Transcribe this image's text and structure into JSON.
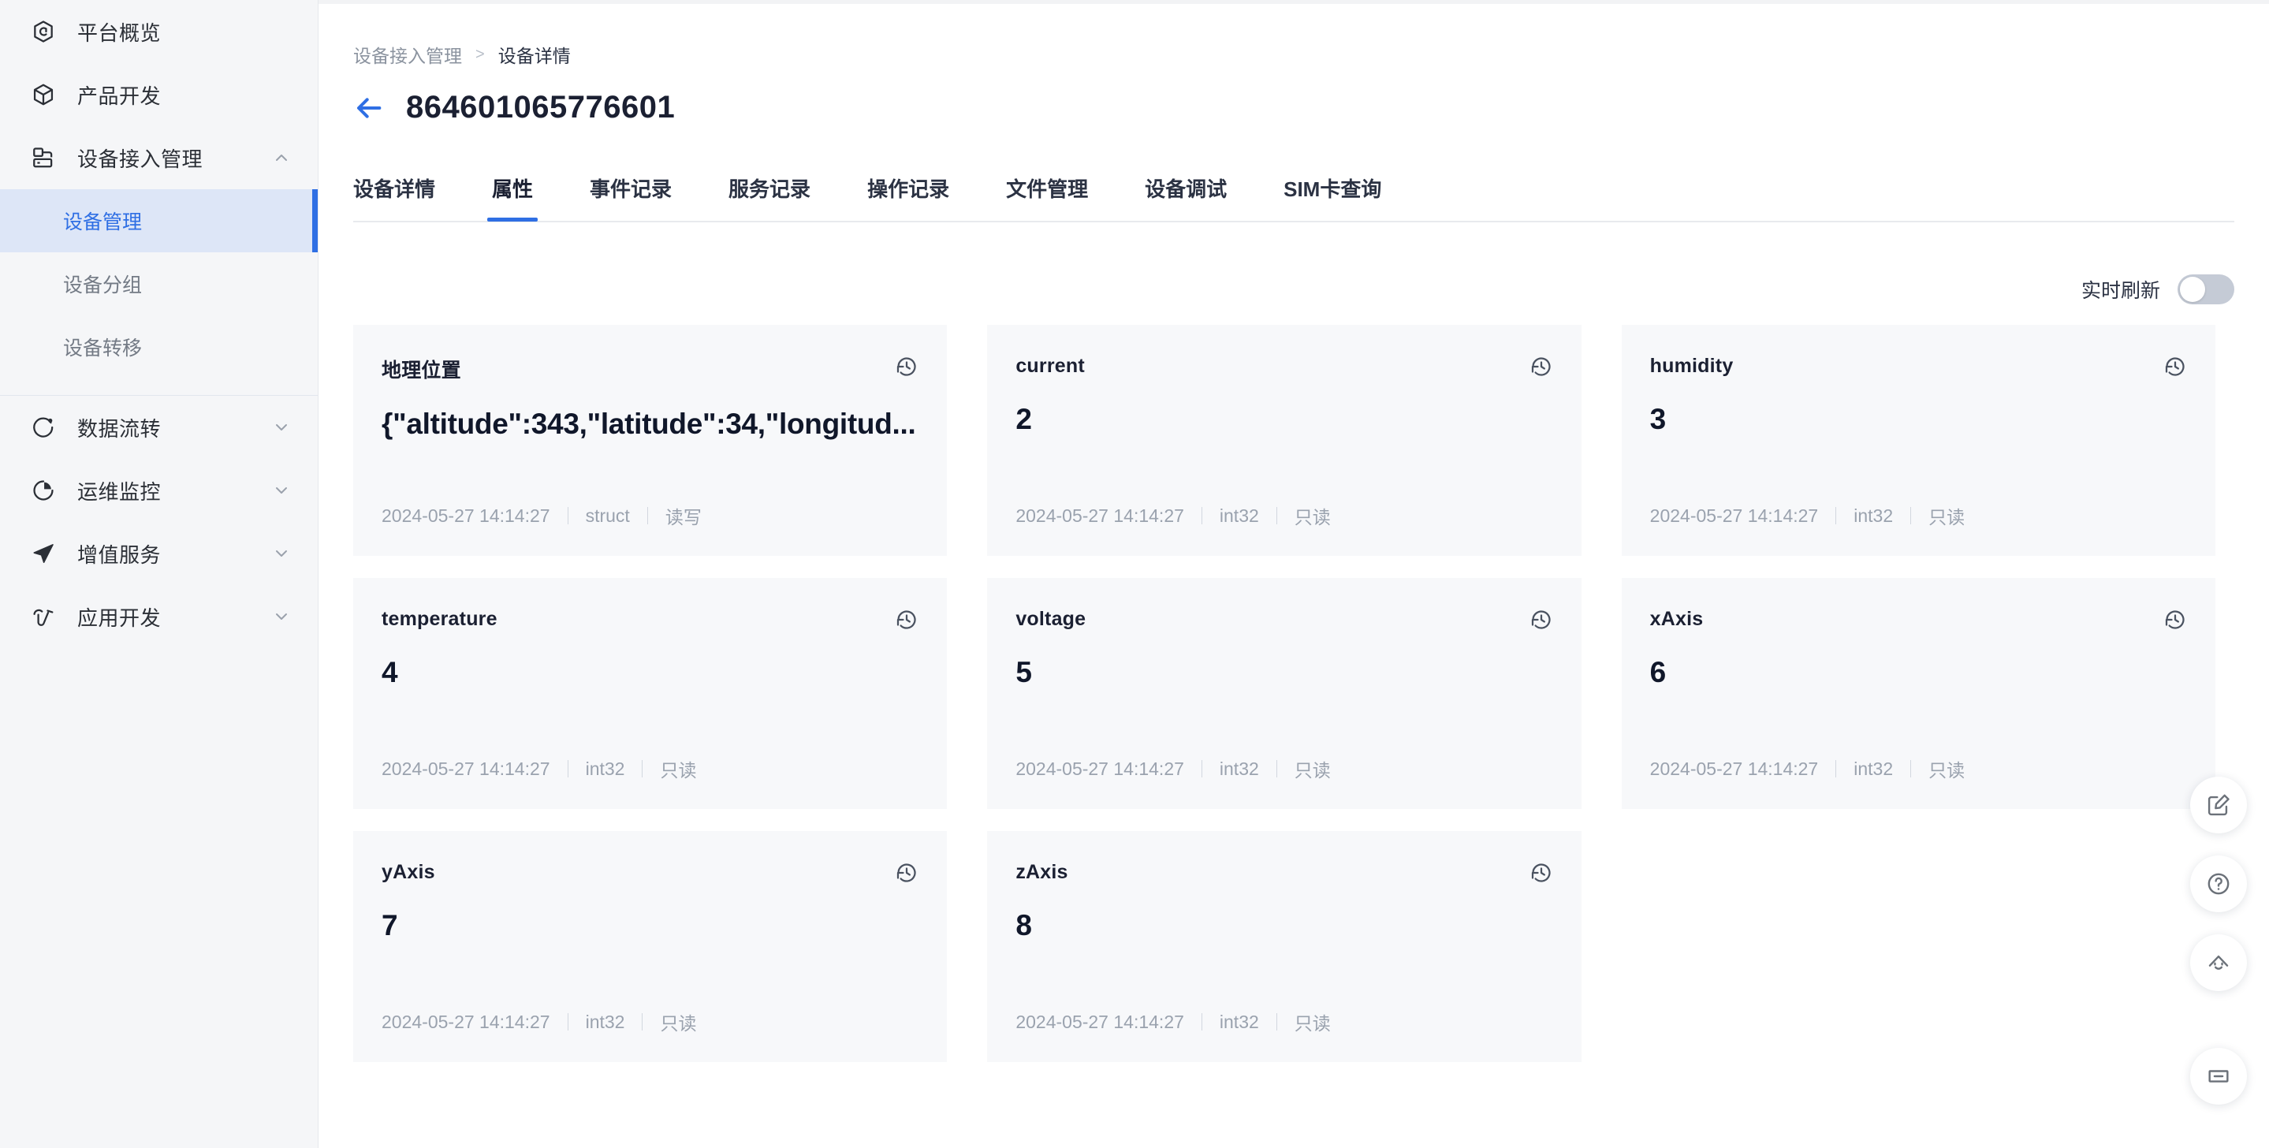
{
  "sidebar": {
    "items": [
      {
        "label": "平台概览",
        "icon": "hexagon-c-icon",
        "expandable": false,
        "active": false
      },
      {
        "label": "产品开发",
        "icon": "cube-icon",
        "expandable": false,
        "active": false
      },
      {
        "label": "设备接入管理",
        "icon": "device-access-icon",
        "expandable": true,
        "expanded": true,
        "chevron": "chevron-up-icon"
      },
      {
        "label": "数据流转",
        "icon": "data-flow-icon",
        "expandable": true,
        "expanded": false,
        "chevron": "chevron-down-icon"
      },
      {
        "label": "运维监控",
        "icon": "pie-monitor-icon",
        "expandable": true,
        "expanded": false,
        "chevron": "chevron-down-icon"
      },
      {
        "label": "增值服务",
        "icon": "paper-plane-icon",
        "expandable": true,
        "expanded": false,
        "chevron": "chevron-down-icon"
      },
      {
        "label": "应用开发",
        "icon": "pulse-icon",
        "expandable": true,
        "expanded": false,
        "chevron": "chevron-down-icon"
      }
    ],
    "sub_items": [
      {
        "label": "设备管理",
        "active": true
      },
      {
        "label": "设备分组",
        "active": false
      },
      {
        "label": "设备转移",
        "active": false
      }
    ]
  },
  "breadcrumb": {
    "parent": "设备接入管理",
    "separator": ">",
    "current": "设备详情"
  },
  "header": {
    "back_icon": "arrow-left-icon",
    "title": "864601065776601"
  },
  "tabs": [
    {
      "label": "设备详情",
      "active": false
    },
    {
      "label": "属性",
      "active": true
    },
    {
      "label": "事件记录",
      "active": false
    },
    {
      "label": "服务记录",
      "active": false
    },
    {
      "label": "操作记录",
      "active": false
    },
    {
      "label": "文件管理",
      "active": false
    },
    {
      "label": "设备调试",
      "active": false
    },
    {
      "label": "SIM卡查询",
      "active": false
    }
  ],
  "refresh": {
    "label": "实时刷新",
    "enabled": false
  },
  "cards": [
    {
      "name": "地理位置",
      "value": "{\"altitude\":343,\"latitude\":34,\"longitud...",
      "timestamp": "2024-05-27 14:14:27",
      "datatype": "struct",
      "access": "读写",
      "history_icon": "history-icon"
    },
    {
      "name": "current",
      "value": "2",
      "timestamp": "2024-05-27 14:14:27",
      "datatype": "int32",
      "access": "只读",
      "history_icon": "history-icon"
    },
    {
      "name": "humidity",
      "value": "3",
      "timestamp": "2024-05-27 14:14:27",
      "datatype": "int32",
      "access": "只读",
      "history_icon": "history-icon"
    },
    {
      "name": "temperature",
      "value": "4",
      "timestamp": "2024-05-27 14:14:27",
      "datatype": "int32",
      "access": "只读",
      "history_icon": "history-icon"
    },
    {
      "name": "voltage",
      "value": "5",
      "timestamp": "2024-05-27 14:14:27",
      "datatype": "int32",
      "access": "只读",
      "history_icon": "history-icon"
    },
    {
      "name": "xAxis",
      "value": "6",
      "timestamp": "2024-05-27 14:14:27",
      "datatype": "int32",
      "access": "只读",
      "history_icon": "history-icon"
    },
    {
      "name": "yAxis",
      "value": "7",
      "timestamp": "2024-05-27 14:14:27",
      "datatype": "int32",
      "access": "只读",
      "history_icon": "history-icon"
    },
    {
      "name": "zAxis",
      "value": "8",
      "timestamp": "2024-05-27 14:14:27",
      "datatype": "int32",
      "access": "只读",
      "history_icon": "history-icon"
    }
  ],
  "floating_buttons": [
    {
      "icon": "feedback-edit-icon"
    },
    {
      "icon": "help-question-icon"
    },
    {
      "icon": "smiley-robot-icon"
    },
    {
      "icon": "minimize-icon"
    }
  ],
  "colors": {
    "accent": "#2f6fe4",
    "card_bg": "#f7f8fa",
    "sidebar_bg": "#f5f6f8",
    "active_nav_bg": "#dde6f7",
    "text_primary": "#1b2032",
    "text_muted": "#9aa2ae"
  }
}
